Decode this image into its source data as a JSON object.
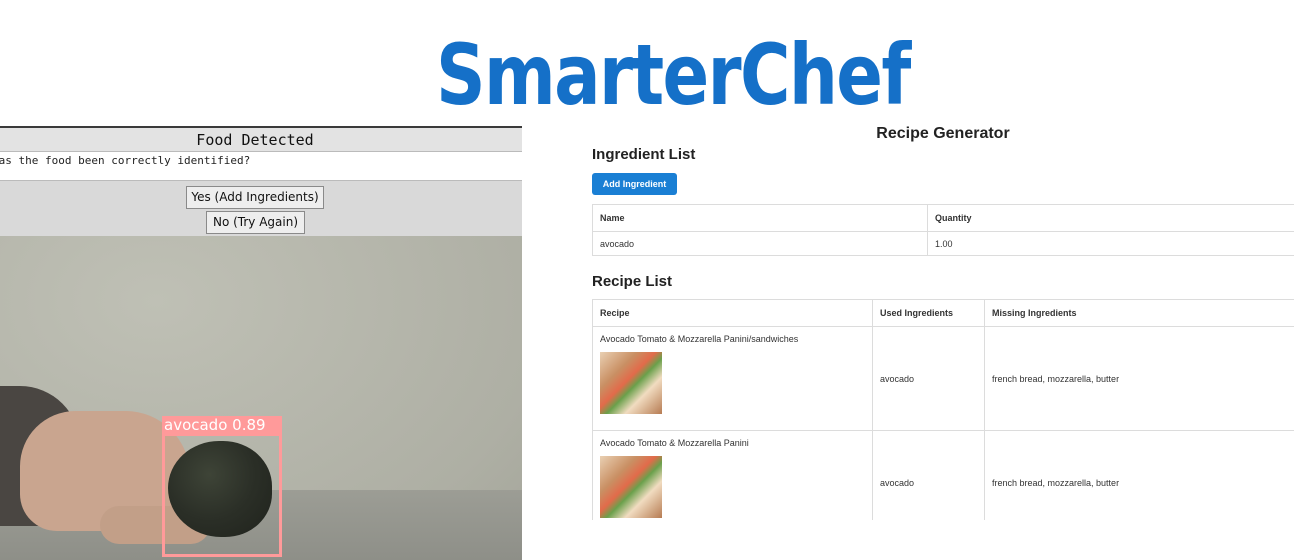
{
  "app": {
    "title": "SmarterChef"
  },
  "detection": {
    "window_title": "Food Detected",
    "question": "Has the food been correctly identified?",
    "yes_label": "Yes (Add Ingredients)",
    "no_label": "No (Try Again)",
    "detection_label": "avocado 0.89"
  },
  "recipe_generator": {
    "heading": "Recipe Generator",
    "ingredient_list_heading": "Ingredient List",
    "add_ingredient_label": "Add Ingredient",
    "ingredient_columns": [
      "Name",
      "Quantity"
    ],
    "ingredients": [
      {
        "name": "avocado",
        "quantity": "1.00"
      }
    ],
    "recipe_list_heading": "Recipe List",
    "recipe_columns": [
      "Recipe",
      "Used Ingredients",
      "Missing Ingredients"
    ],
    "recipes": [
      {
        "name": "Avocado Tomato & Mozzarella Panini/sandwiches",
        "used": "avocado",
        "missing": "french bread, mozzarella, butter"
      },
      {
        "name": "Avocado Tomato & Mozzarella Panini",
        "used": "avocado",
        "missing": "french bread, mozzarella, butter"
      }
    ]
  },
  "colors": {
    "brand": "#1570c8",
    "button": "#1a7fd4",
    "bbox": "#ff9a9a"
  }
}
